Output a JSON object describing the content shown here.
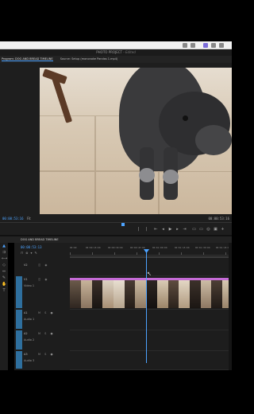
{
  "window": {
    "project_title": "PHOTO PROJECT",
    "edited_label": "Edited"
  },
  "tabs": {
    "program_tab": "Program: DOG AND BREAD TIMELINE",
    "source_tab": "Source: Setup (mononoke Pandas 1.mp4)"
  },
  "monitor": {
    "timecode_current": "00:00:53:16",
    "fit_label": "Fit",
    "timecode_end": "00:00:53:16"
  },
  "timeline": {
    "sequence_name": "DOG AND BREAD TIMELINE",
    "timecode": "00:00:53:13",
    "ruler_labels": [
      "00:00",
      "00:00:15:00",
      "00:00:30:00",
      "00:00:45:00",
      "00:01:00:00",
      "00:01:15:00",
      "00:01:30:00",
      "00:01:45:00"
    ],
    "tracks": [
      {
        "id": "V2",
        "name": ""
      },
      {
        "id": "V1",
        "name": "Video 1"
      },
      {
        "id": "A1",
        "name": "Audio 1"
      },
      {
        "id": "A2",
        "name": "Audio 2"
      },
      {
        "id": "A3",
        "name": "Audio 3"
      }
    ]
  },
  "colors": {
    "accent": "#4da3ff",
    "clip_header": "#c56bd6",
    "panel_bg": "#1d1d1d"
  }
}
